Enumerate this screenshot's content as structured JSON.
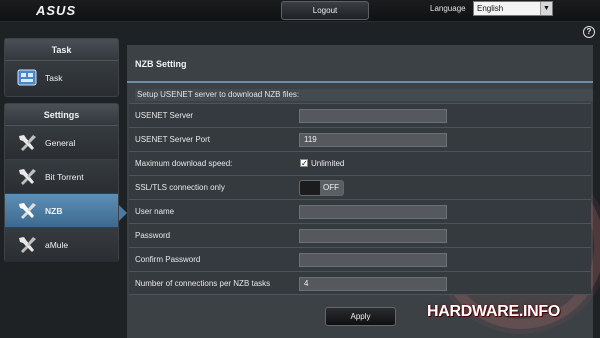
{
  "header": {
    "logo": "ASUS",
    "logout_label": "Logout",
    "language_label": "Language",
    "language_value": "English",
    "help": "?"
  },
  "sidebar": {
    "task_heading": "Task",
    "task_items": [
      {
        "label": "Task",
        "icon": "task-icon"
      }
    ],
    "settings_heading": "Settings",
    "settings_items": [
      {
        "label": "General",
        "icon": "tools-icon"
      },
      {
        "label": "Bit Torrent",
        "icon": "tools-icon"
      },
      {
        "label": "NZB",
        "icon": "tools-icon",
        "active": true
      },
      {
        "label": "aMule",
        "icon": "tools-icon"
      }
    ]
  },
  "main": {
    "title": "NZB Setting",
    "description": "Setup USENET server to download NZB files:",
    "fields": [
      {
        "label": "USENET Server",
        "value": ""
      },
      {
        "label": "USENET Server Port",
        "value": "119"
      },
      {
        "label": "Maximum download speed:",
        "checkbox_label": "Unlimited",
        "checked": true
      },
      {
        "label": "SSL/TLS connection only",
        "toggle_label": "OFF"
      },
      {
        "label": "User name",
        "value": ""
      },
      {
        "label": "Password",
        "value": ""
      },
      {
        "label": "Confirm Password",
        "value": ""
      },
      {
        "label": "Number of connections per NZB tasks",
        "value": "4"
      }
    ],
    "apply_label": "Apply"
  },
  "watermark": {
    "brand_text": "HARDWARE.INFO",
    "badge_letter": "H"
  },
  "colors": {
    "accent": "#4b7ba2",
    "panel": "#3c4146",
    "background": "#1f2225"
  }
}
